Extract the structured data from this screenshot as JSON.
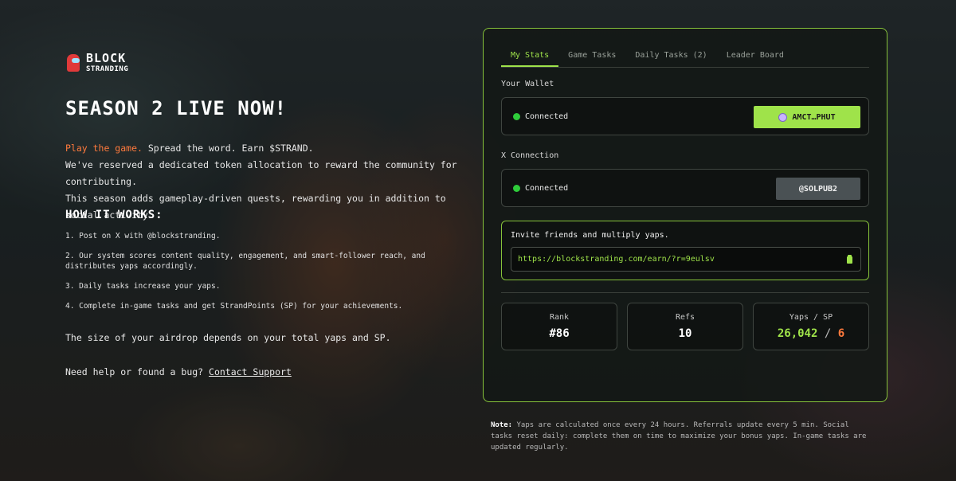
{
  "brand": {
    "line1": "BLOCK",
    "line2": "STRANDING"
  },
  "hero": {
    "title": "SEASON 2 LIVE NOW!",
    "play": "Play the game.",
    "tagline_rest": " Spread the word. Earn $STRAND.",
    "line2": "We've reserved a dedicated token allocation to reward the community for contributing.",
    "line3": "This season adds gameplay-driven quests, rewarding you in addition to social activity."
  },
  "how": {
    "title": "HOW IT WORKS:",
    "steps": [
      "1. Post on X with @blockstranding.",
      "2. Our system scores content quality, engagement, and smart-follower reach, and distributes yaps accordingly.",
      "3. Daily tasks increase your yaps.",
      "4. Complete in-game tasks and get StrandPoints (SP) for your achievements."
    ],
    "airdrop": "The size of your airdrop depends on your total yaps and SP.",
    "help_text": "Need help or found a bug? ",
    "help_link": "Contact Support"
  },
  "tabs": [
    "My Stats",
    "Game Tasks",
    "Daily Tasks (2)",
    "Leader Board"
  ],
  "wallet": {
    "label": "Your Wallet",
    "status": "Connected",
    "button": "AMCT…PHUT",
    "icon": "phantom-wallet-icon"
  },
  "xconn": {
    "label": "X Connection",
    "status": "Connected",
    "button": "@SOLPUB2"
  },
  "invite": {
    "title": "Invite friends and multiply yaps.",
    "url": "https://blockstranding.com/earn/?r=9eulsv"
  },
  "stats": {
    "rank_label": "Rank",
    "rank_value": "#86",
    "refs_label": "Refs",
    "refs_value": "10",
    "yaps_label": "Yaps / SP",
    "yaps_value": "26,042",
    "slash": " / ",
    "sp_value": "6"
  },
  "note": {
    "prefix": "Note:",
    "text": " Yaps are calculated once every 24 hours. Referrals update every 5 min. Social tasks reset daily: complete them on time to maximize your bonus yaps. In-game tasks are updated regularly."
  },
  "colors": {
    "accent_green": "#9fe34a",
    "accent_orange": "#ff7a3d",
    "status_green": "#2ecc3a"
  }
}
